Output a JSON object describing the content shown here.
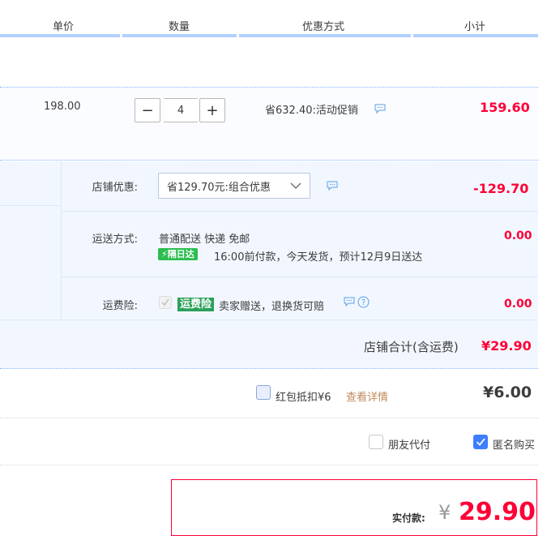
{
  "header": {
    "col_price": "单价",
    "col_qty": "数量",
    "col_discount": "优惠方式",
    "col_subtotal": "小计"
  },
  "item": {
    "unit_price": "198.00",
    "quantity": "4",
    "minus": "−",
    "plus": "+",
    "discount_text": "省632.40:活动促销",
    "subtotal": "159.60"
  },
  "shop": {
    "discount_label": "店铺优惠:",
    "discount_select": "省129.70元:组合优惠",
    "discount_amount": "-129.70",
    "shipping_label": "运送方式:",
    "shipping_method": "普通配送 快递 免邮",
    "shipping_badge": "隔日达",
    "shipping_note": "16:00前付款，今天发货，预计12月9日送达",
    "shipping_amount": "0.00",
    "insurance_label": "运费险:",
    "insurance_badge": "运费险",
    "insurance_text": "卖家赠送，退换货可赔",
    "insurance_amount": "0.00",
    "total_label": "店铺合计(含运费)",
    "total_amount": "¥29.90"
  },
  "redpacket": {
    "label": "红包抵扣¥6",
    "details_link": "查看详情",
    "amount": "¥6.00"
  },
  "options": {
    "friend_pay": "朋友代付",
    "anonymous": "匿名购买",
    "anonymous_checked": true
  },
  "payment": {
    "label": "实付款:",
    "currency": "¥",
    "amount": "29.90"
  },
  "colors": {
    "accent_red": "#ff0036",
    "header_line": "#b2d1ff",
    "shop_bg": "#f2f7ff",
    "checkbox_blue": "#3d7eff"
  }
}
